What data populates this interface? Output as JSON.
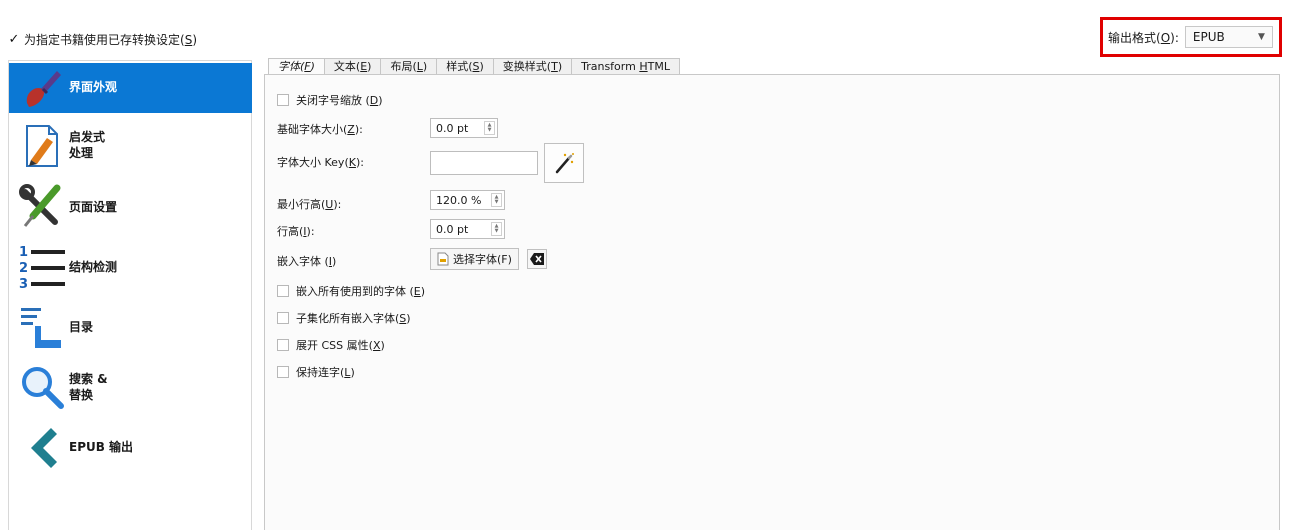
{
  "top": {
    "use_saved_checked_mark": "✓",
    "use_saved_label_main": "为指定书籍使用已存转换设定(",
    "use_saved_key": "S",
    "use_saved_label_end": ")",
    "output_format_label_main": "输出格式(",
    "output_format_key": "O",
    "output_format_label_end": "):",
    "output_format_value": "EPUB",
    "highlight_color": "#e00000"
  },
  "sidebar": {
    "items": [
      {
        "label": "界面外观",
        "icon": "brush-icon"
      },
      {
        "label": "启发式\n处理",
        "icon": "document-pencil-icon"
      },
      {
        "label": "页面设置",
        "icon": "wrench-screwdriver-icon"
      },
      {
        "label": "结构检测",
        "icon": "numbered-list-icon"
      },
      {
        "label": "目录",
        "icon": "toc-icon"
      },
      {
        "label": "搜索 &\n替换",
        "icon": "magnifier-icon"
      },
      {
        "label": "EPUB 输出",
        "icon": "epub-arrow-icon"
      }
    ],
    "active_color": "#0b78d4"
  },
  "tabs": [
    {
      "label": "字体(",
      "key": "F",
      "end": ")"
    },
    {
      "label": "文本(",
      "key": "E",
      "end": ")"
    },
    {
      "label": "布局(",
      "key": "L",
      "end": ")"
    },
    {
      "label": "样式(",
      "key": "S",
      "end": ")"
    },
    {
      "label": "变换样式(",
      "key": "T",
      "end": ")"
    },
    {
      "label": "Transform ",
      "key": "H",
      "end": "TML"
    }
  ],
  "font_tab": {
    "disable_font_rescaling": {
      "label": "关闭字号缩放 (",
      "key": "D",
      "end": ")"
    },
    "base_font_size": {
      "label": "基础字体大小(",
      "key": "Z",
      "end": "):",
      "value": "0.0 pt"
    },
    "font_size_key": {
      "label": "字体大小 Key(",
      "key": "K",
      "end": "):",
      "value": ""
    },
    "min_line_height": {
      "label": "最小行高(",
      "key": "U",
      "end": "):",
      "value": "120.0 %"
    },
    "line_height": {
      "label": "行高(",
      "key": "I",
      "end": "):",
      "value": "0.0 pt"
    },
    "embed_font": {
      "label": "嵌入字体 (",
      "key": "I",
      "end": ")",
      "button": "选择字体(F)"
    },
    "embed_all_fonts": {
      "label": "嵌入所有使用到的字体 (",
      "key": "E",
      "end": ")"
    },
    "subset_fonts": {
      "label": "子集化所有嵌入字体(",
      "key": "S",
      "end": ")"
    },
    "expand_css": {
      "label": "展开 CSS 属性(",
      "key": "X",
      "end": ")"
    },
    "keep_ligatures": {
      "label": "保持连字(",
      "key": "L",
      "end": ")"
    }
  }
}
